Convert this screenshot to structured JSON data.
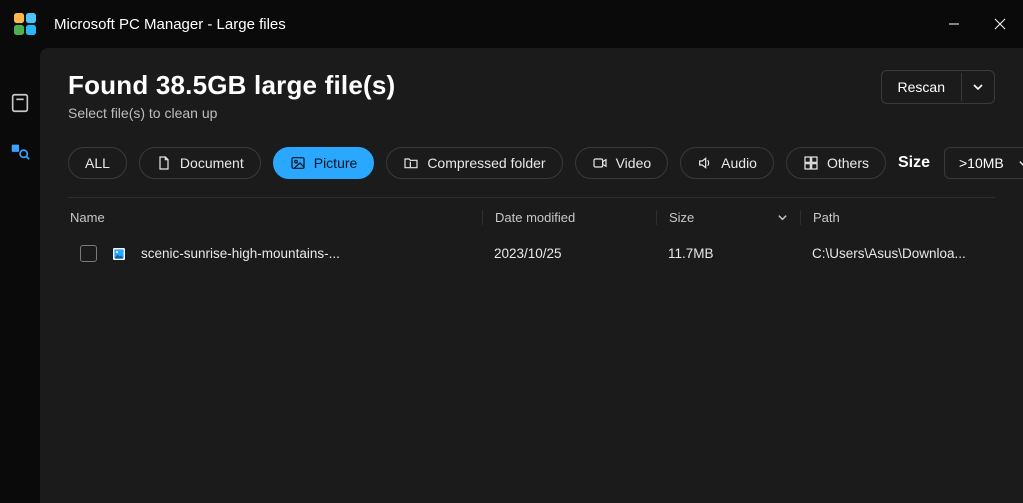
{
  "titlebar": {
    "app_title": "Microsoft PC Manager - Large files"
  },
  "header": {
    "title": "Found 38.5GB large file(s)",
    "subtitle": "Select file(s) to clean up",
    "rescan_label": "Rescan"
  },
  "filters": {
    "all": "ALL",
    "document": "Document",
    "picture": "Picture",
    "compressed": "Compressed folder",
    "video": "Video",
    "audio": "Audio",
    "others": "Others"
  },
  "size_filter": {
    "label": "Size",
    "selected": ">10MB"
  },
  "columns": {
    "name": "Name",
    "date": "Date modified",
    "size": "Size",
    "path": "Path"
  },
  "rows": [
    {
      "name": "scenic-sunrise-high-mountains-...",
      "date": "2023/10/25",
      "size": "11.7MB",
      "path": "C:\\Users\\Asus\\Downloa..."
    }
  ]
}
